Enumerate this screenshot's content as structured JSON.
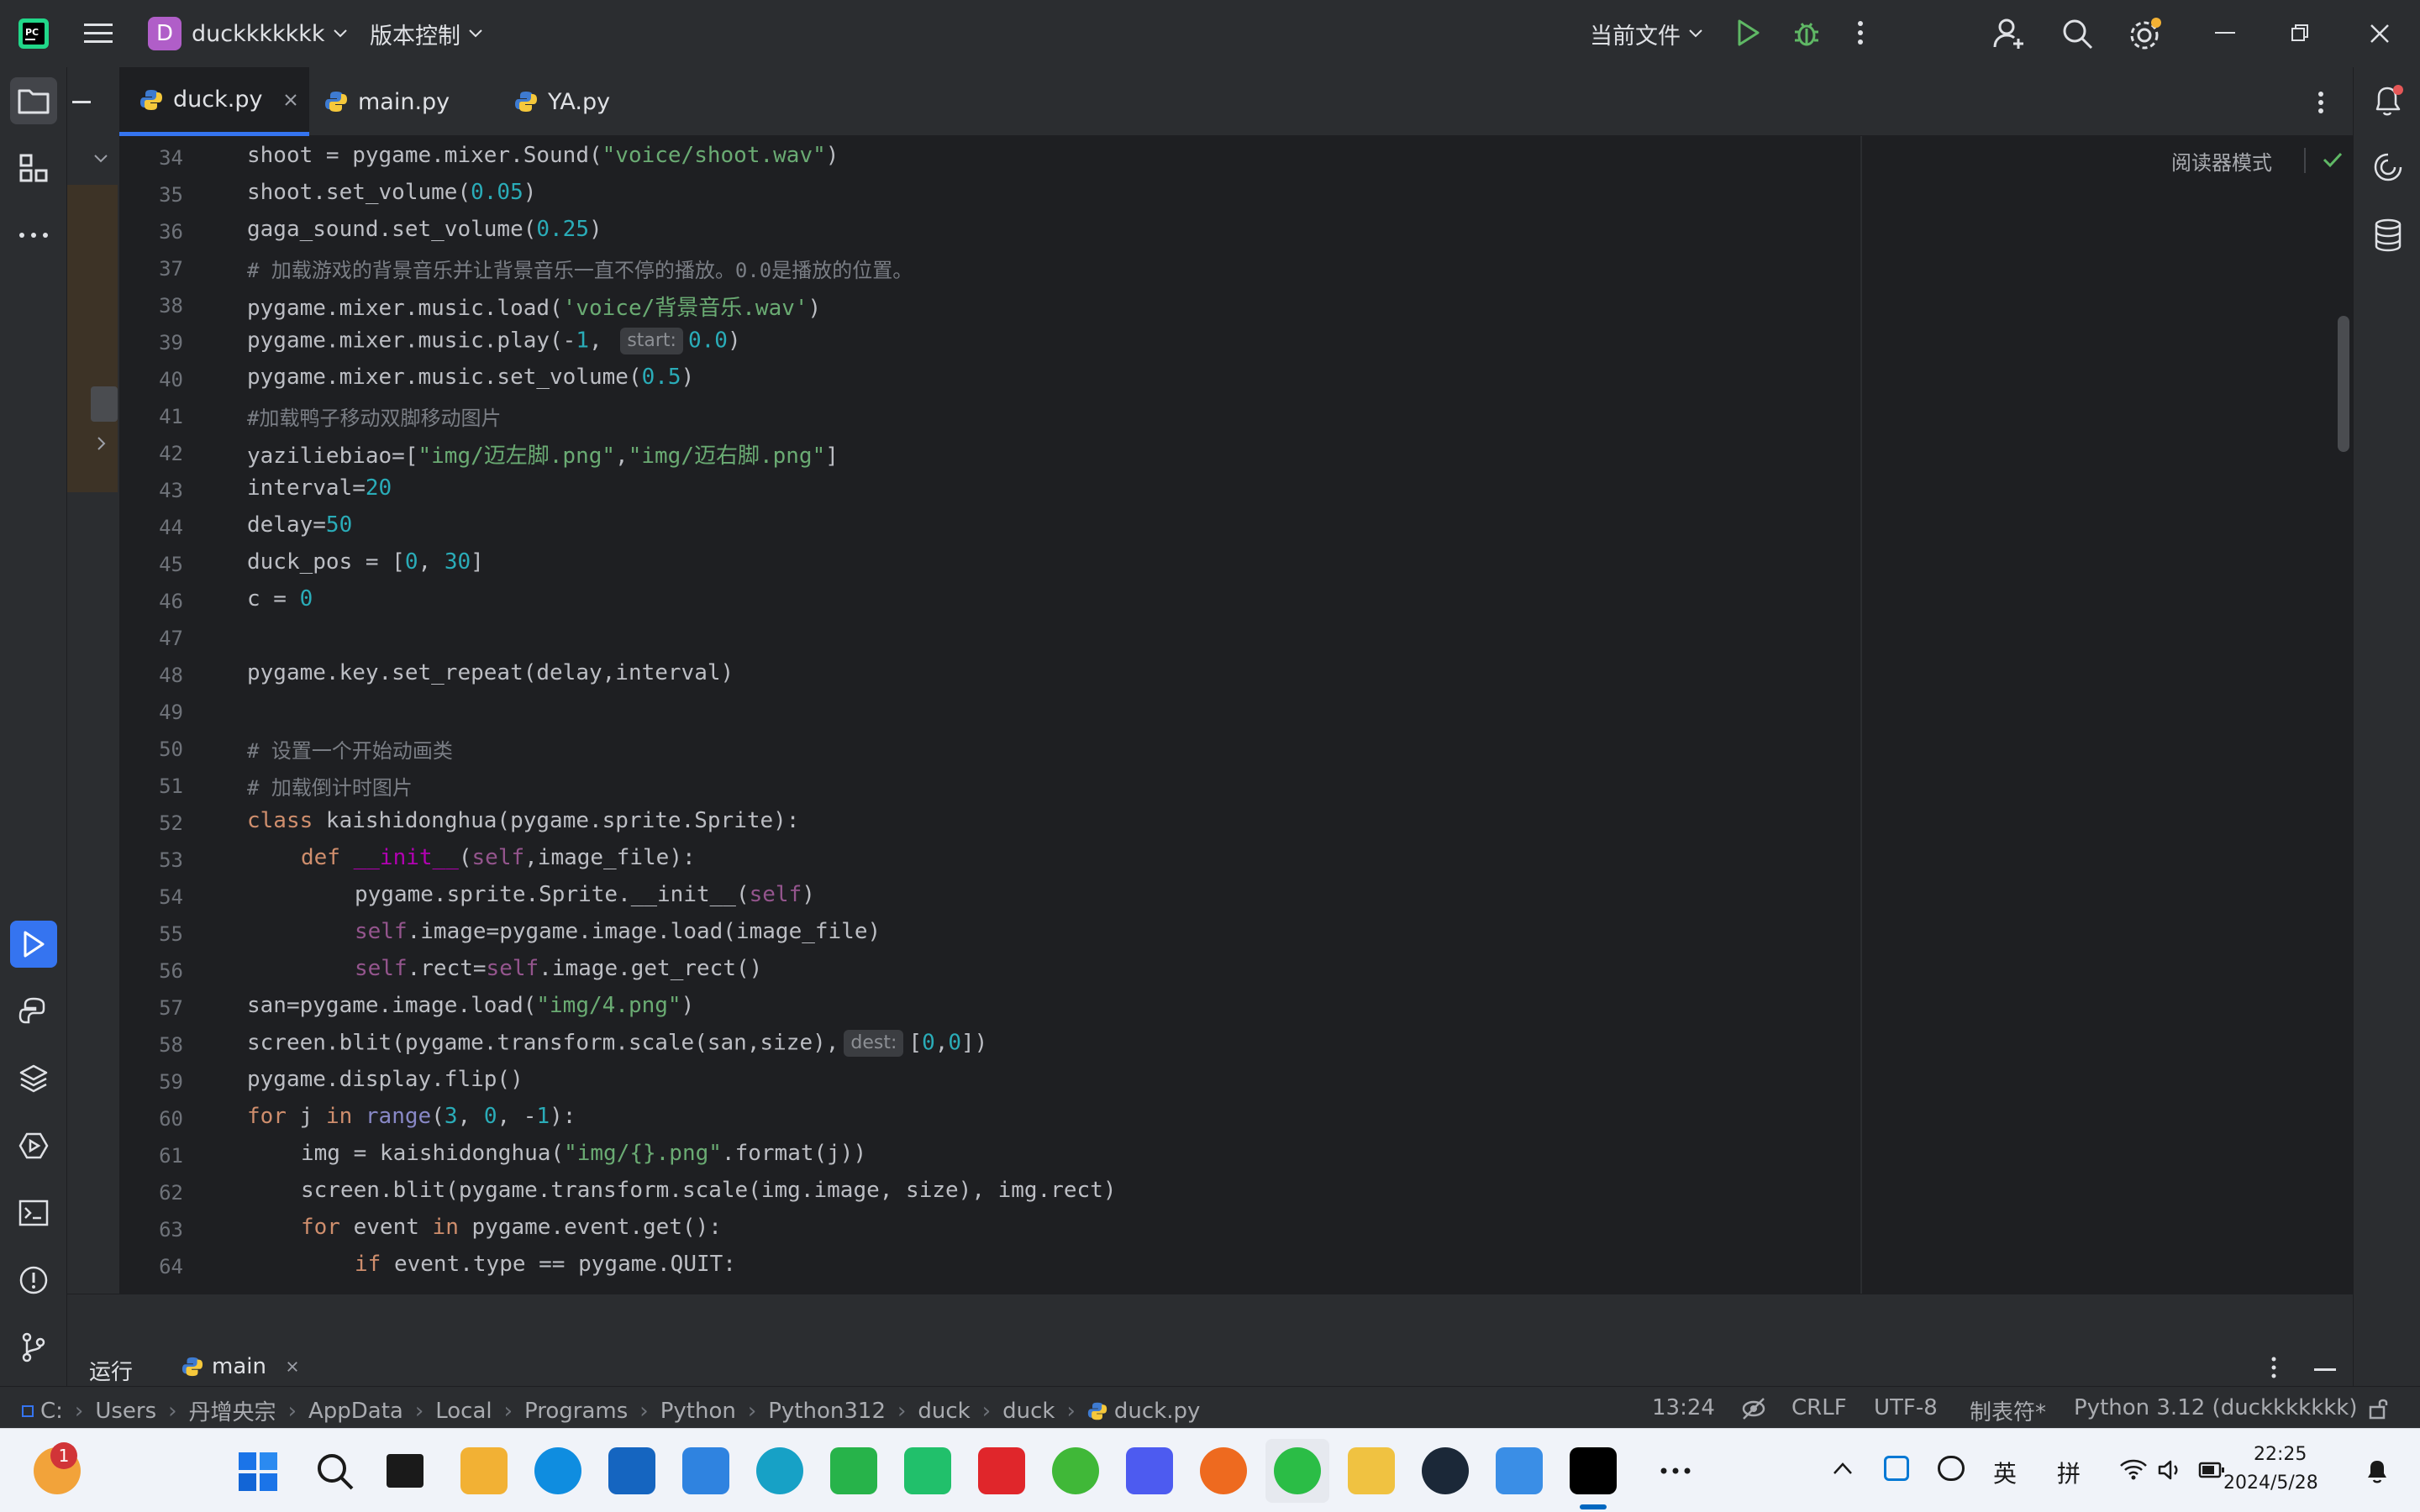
{
  "titlebar": {
    "project_badge": "D",
    "project_name": "duckkkkkkk",
    "vcs_label": "版本控制",
    "run_config": "当前文件"
  },
  "tabs": [
    {
      "label": "duck.py",
      "active": true
    },
    {
      "label": "main.py",
      "active": false
    },
    {
      "label": "YA.py",
      "active": false
    }
  ],
  "editor": {
    "reader_mode": "阅读器模式",
    "lines": [
      {
        "n": "34"
      },
      {
        "n": "35"
      },
      {
        "n": "36"
      },
      {
        "n": "37"
      },
      {
        "n": "38"
      },
      {
        "n": "39"
      },
      {
        "n": "40"
      },
      {
        "n": "41"
      },
      {
        "n": "42"
      },
      {
        "n": "43"
      },
      {
        "n": "44"
      },
      {
        "n": "45"
      },
      {
        "n": "46"
      },
      {
        "n": "47"
      },
      {
        "n": "48"
      },
      {
        "n": "49"
      },
      {
        "n": "50"
      },
      {
        "n": "51"
      },
      {
        "n": "52"
      },
      {
        "n": "53"
      },
      {
        "n": "54"
      },
      {
        "n": "55"
      },
      {
        "n": "56"
      },
      {
        "n": "57"
      },
      {
        "n": "58"
      },
      {
        "n": "59"
      },
      {
        "n": "60"
      },
      {
        "n": "61"
      },
      {
        "n": "62"
      },
      {
        "n": "63"
      },
      {
        "n": "64"
      }
    ],
    "code": {
      "l34a": "shoot = pygame.mixer.Sound(",
      "l34s": "\"voice/shoot.wav\"",
      "l34b": ")",
      "l35a": "shoot.set_volume(",
      "l35n": "0.05",
      "l35b": ")",
      "l36a": "gaga_sound.set_volume(",
      "l36n": "0.25",
      "l36b": ")",
      "l37": "# 加载游戏的背景音乐并让背景音乐一直不停的播放。0.0是播放的位置。",
      "l38a": "pygame.mixer.music.load(",
      "l38s": "'voice/背景音乐.wav'",
      "l38b": ")",
      "l39a": "pygame.mixer.music.play(-",
      "l39n": "1",
      "l39c": ",",
      "l39h": "start:",
      "l39n2": "0.0",
      "l39b": ")",
      "l40a": "pygame.mixer.music.set_volume(",
      "l40n": "0.5",
      "l40b": ")",
      "l41": "#加载鸭子移动双脚移动图片",
      "l42a": "yaziliebiao=[",
      "l42s1": "\"img/迈左脚.png\"",
      "l42c": ",",
      "l42s2": "\"img/迈右脚.png\"",
      "l42b": "]",
      "l43a": "interval=",
      "l43n": "20",
      "l44a": "delay=",
      "l44n": "50",
      "l45a": "duck_pos = [",
      "l45n1": "0",
      "l45c": ", ",
      "l45n2": "30",
      "l45b": "]",
      "l46a": "c = ",
      "l46n": "0",
      "l48": "pygame.key.set_repeat(delay,interval)",
      "l50": "# 设置一个开始动画类",
      "l51": "# 加载倒计时图片",
      "l52k": "class",
      "l52a": " kaishidonghua(pygame.sprite.Sprite):",
      "l53k": "def",
      "l53d": "__init__",
      "l53a": "(",
      "l53s": "self",
      "l53b": ",image_file):",
      "l54a": "pygame.sprite.Sprite.__init__(",
      "l54s": "self",
      "l54b": ")",
      "l55s": "self",
      "l55a": ".image=pygame.image.load(image_file)",
      "l56s": "self",
      "l56a": ".rect=",
      "l56s2": "self",
      "l56b": ".image.get_rect()",
      "l57a": "san=pygame.image.load(",
      "l57s": "\"img/4.png\"",
      "l57b": ")",
      "l58a": "screen.blit(pygame.transform.scale(san,size),",
      "l58h": "dest:",
      "l58b": "[",
      "l58n1": "0",
      "l58c": ",",
      "l58n2": "0",
      "l58d": "])",
      "l59": "pygame.display.flip()",
      "l60k": "for",
      "l60a": " j ",
      "l60k2": "in",
      "l60sp": " ",
      "l60bi": "range",
      "l60b": "(",
      "l60n1": "3",
      "l60c1": ", ",
      "l60n2": "0",
      "l60c2": ", -",
      "l60n3": "1",
      "l60d": "):",
      "l61a": "img = kaishidonghua(",
      "l61s": "\"img/{}.png\"",
      "l61b": ".format(j))",
      "l62": "screen.blit(pygame.transform.scale(img.image, size), img.rect)",
      "l63k": "for",
      "l63a": " event ",
      "l63k2": "in",
      "l63b": " pygame.event.get():",
      "l64k": "if",
      "l64a": " event.type == pygame.QUIT:"
    }
  },
  "bottom": {
    "run_label": "运行",
    "run_tab": "main"
  },
  "statusbar": {
    "breadcrumbs": [
      "C:",
      "Users",
      "丹增央宗",
      "AppData",
      "Local",
      "Programs",
      "Python",
      "Python312",
      "duck",
      "duck",
      "duck.py"
    ],
    "position": "13:24",
    "line_sep": "CRLF",
    "encoding": "UTF-8",
    "indent": "制表符*",
    "interpreter": "Python 3.12 (duckkkkkkk)"
  },
  "taskbar": {
    "badge_count": "1",
    "lang1": "英",
    "lang2": "拼",
    "time": "22:25",
    "date": "2024/5/28"
  },
  "colors": {
    "accent": "#3574f0",
    "keyword": "#cf8e6d",
    "string": "#6aab73",
    "number": "#2aacb8",
    "comment": "#7a7e85"
  }
}
